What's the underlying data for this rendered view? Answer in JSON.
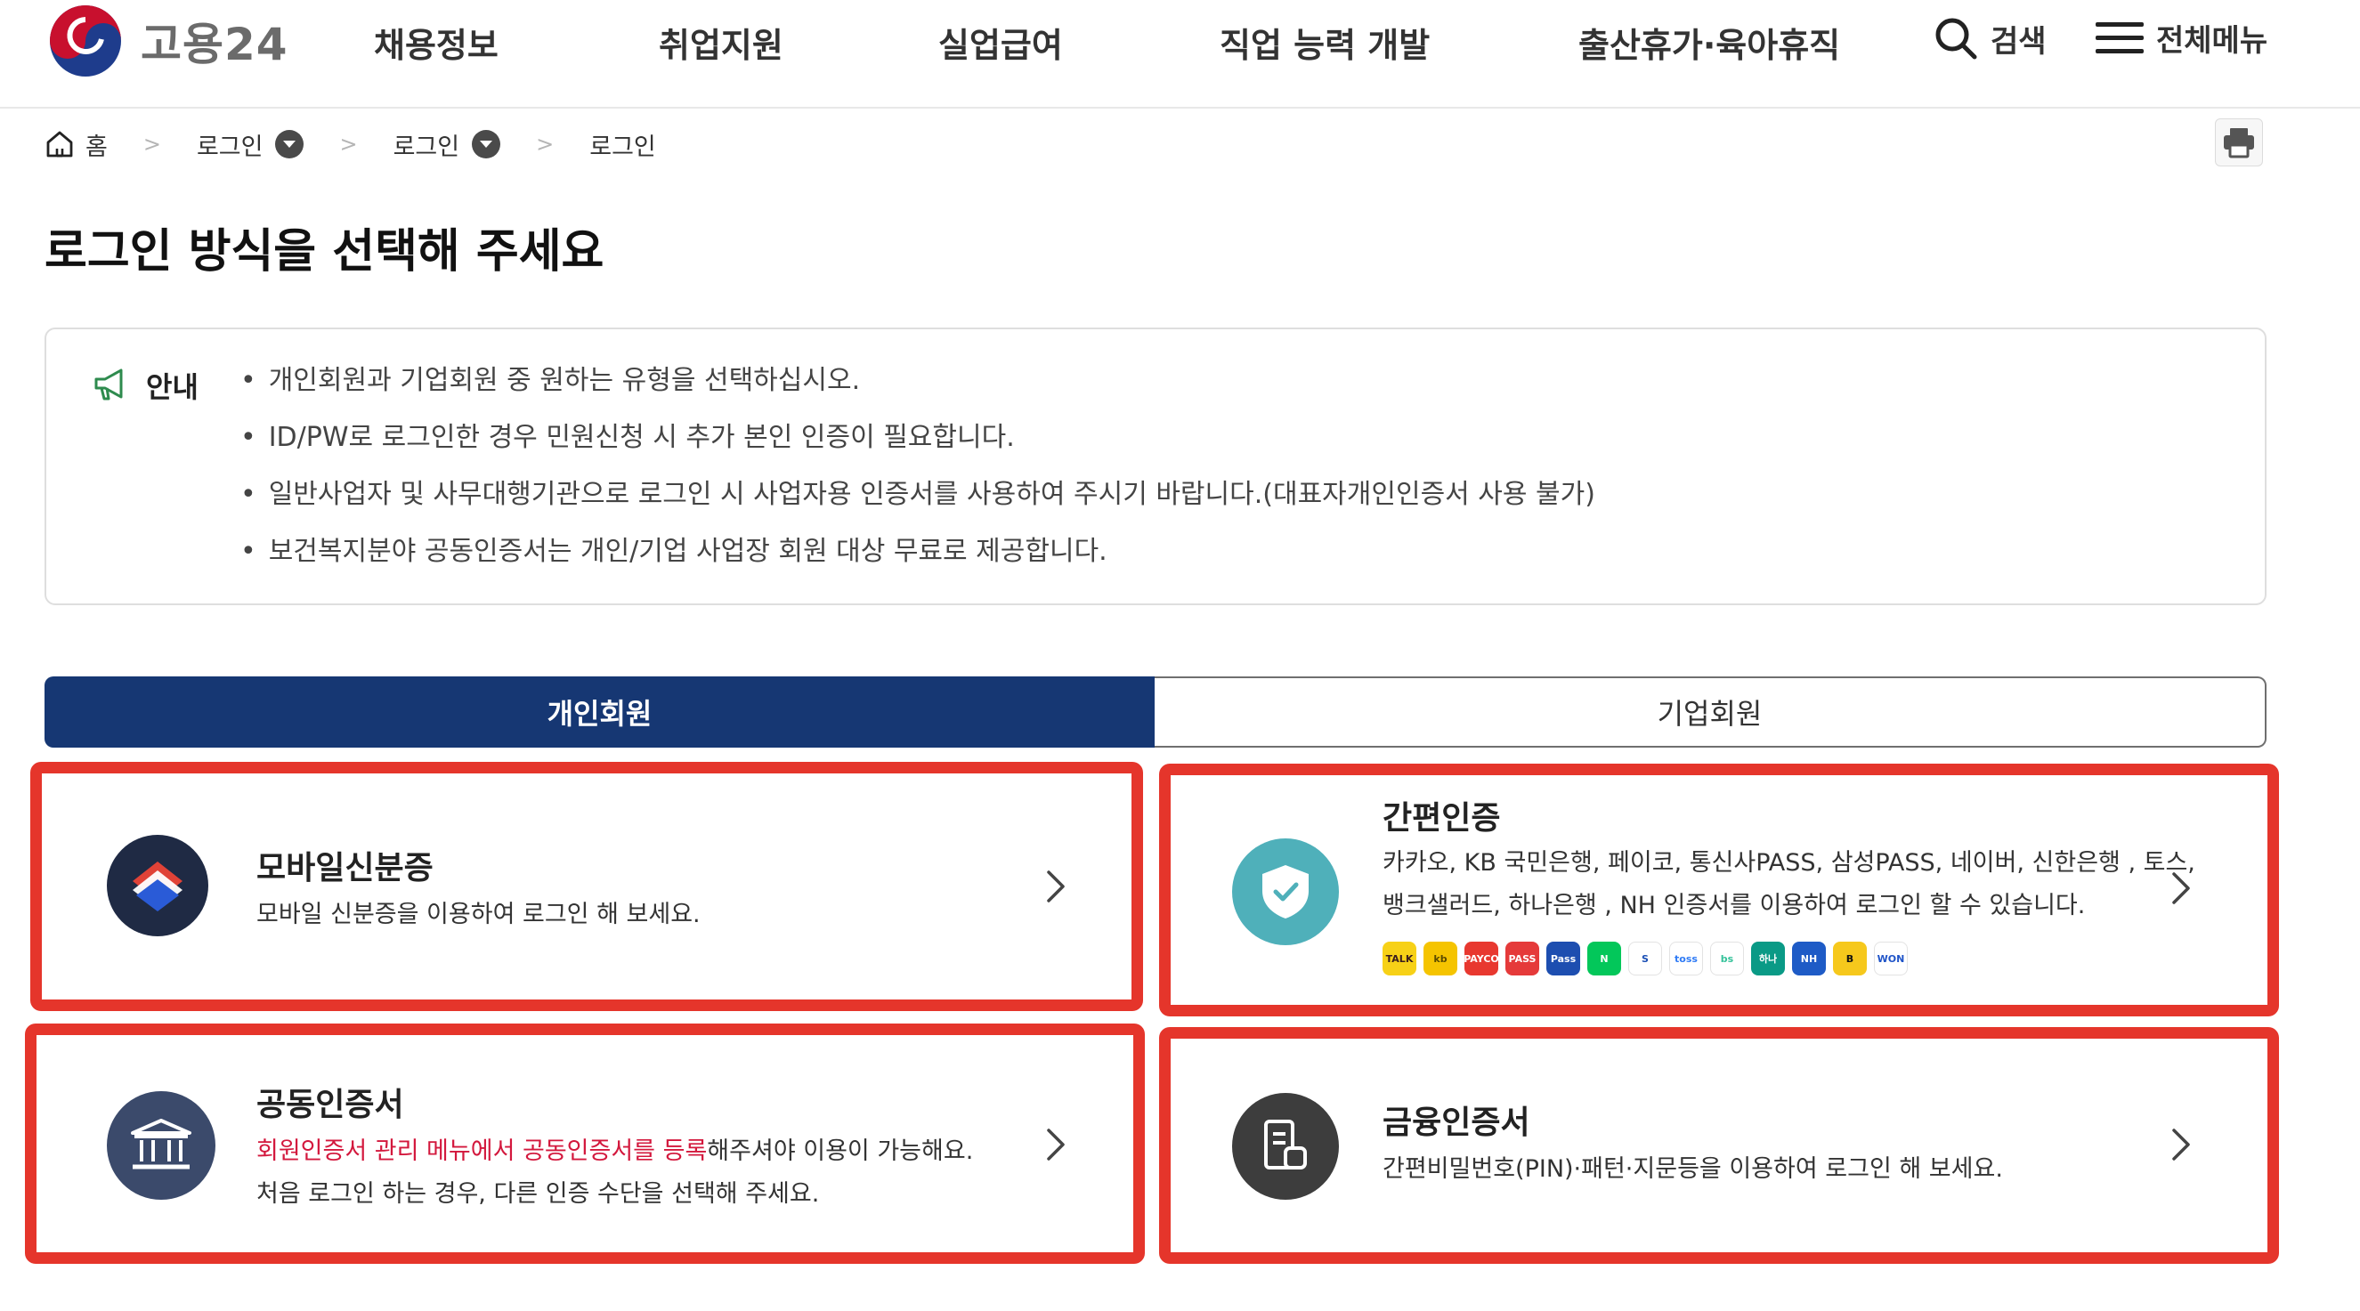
{
  "header": {
    "logo_text": "고용24",
    "nav": [
      "채용정보",
      "취업지원",
      "실업급여",
      "직업 능력 개발",
      "출산휴가·육아휴직"
    ],
    "search_label": "검색",
    "menu_label": "전체메뉴"
  },
  "breadcrumb": {
    "home": "홈",
    "items": [
      "로그인",
      "로그인",
      "로그인"
    ]
  },
  "page_title": "로그인 방식을 선택해 주세요",
  "notice": {
    "label": "안내",
    "items": [
      "개인회원과 기업회원 중 원하는 유형을 선택하십시오.",
      "ID/PW로 로그인한 경우 민원신청 시 추가 본인 인증이 필요합니다.",
      "일반사업자 및 사무대행기관으로 로그인 시 사업자용 인증서를 사용하여 주시기 바랍니다.(대표자개인인증서 사용 불가)",
      "보건복지분야 공동인증서는 개인/기업 사업장 회원 대상 무료로 제공합니다."
    ]
  },
  "tabs": [
    {
      "label": "개인회원",
      "active": true
    },
    {
      "label": "기업회원",
      "active": false
    }
  ],
  "cards": {
    "mobile_id": {
      "title": "모바일신분증",
      "desc": "모바일 신분증을 이용하여 로그인 해 보세요."
    },
    "simple_auth": {
      "title": "간편인증",
      "desc_line1": "카카오, KB 국민은행, 페이코, 통신사PASS, 삼성PASS, 네이버, 신한은행 , 토스,",
      "desc_line2": "뱅크샐러드, 하나은행 , NH 인증서를 이용하여 로그인 할 수 있습니다.",
      "providers": [
        {
          "name": "TALK",
          "color": "#f7d117",
          "text_color": "#3a1d1d"
        },
        {
          "name": "kb",
          "color": "#f5c400",
          "text_color": "#5a4a00"
        },
        {
          "name": "PAYCO",
          "color": "#e8382f",
          "text_color": "#ffffff"
        },
        {
          "name": "PASS",
          "color": "#e53a3a",
          "text_color": "#ffffff"
        },
        {
          "name": "Pass",
          "color": "#1d4eb0",
          "text_color": "#ffffff"
        },
        {
          "name": "N",
          "color": "#03c75a",
          "text_color": "#ffffff"
        },
        {
          "name": "S",
          "color": "#ffffff",
          "text_color": "#1a4fb5"
        },
        {
          "name": "toss",
          "color": "#ffffff",
          "text_color": "#2f7bf5"
        },
        {
          "name": "bs",
          "color": "#ffffff",
          "text_color": "#35c29a"
        },
        {
          "name": "하나",
          "color": "#0a9a86",
          "text_color": "#ffffff"
        },
        {
          "name": "NH",
          "color": "#1e5bc6",
          "text_color": "#ffffff"
        },
        {
          "name": "B",
          "color": "#f6c81c",
          "text_color": "#111111"
        },
        {
          "name": "WON",
          "color": "#ffffff",
          "text_color": "#1f54c8"
        }
      ]
    },
    "joint_cert": {
      "title": "공동인증서",
      "desc_highlight": "회원인증서 관리 메뉴에서 공동인증서를 등록",
      "desc_line1_rest": "해주셔야 이용이 가능해요.",
      "desc_line2": "처음 로그인 하는 경우, 다른 인증 수단을 선택해 주세요."
    },
    "financial_cert": {
      "title": "금융인증서",
      "desc": "간편비밀번호(PIN)·패턴·지문등을 이용하여 로그인 해 보세요."
    }
  },
  "colors": {
    "primary_navy": "#163773",
    "highlight_red": "#e5352b",
    "link_red": "#d3183d",
    "simple_auth_teal": "#4fb0ba"
  }
}
